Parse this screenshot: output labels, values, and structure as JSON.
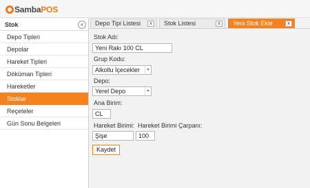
{
  "app": {
    "logo_samba": "Samba",
    "logo_pos": "POS"
  },
  "sidebar": {
    "title": "Stok",
    "collapse_icon": "«",
    "items": [
      {
        "label": "Depo Tipleri"
      },
      {
        "label": "Depolar"
      },
      {
        "label": "Hareket Tipleri"
      },
      {
        "label": "Döküman Tipleri"
      },
      {
        "label": "Hareketler"
      },
      {
        "label": "Stoklar",
        "active": true
      },
      {
        "label": "Reçeteler"
      },
      {
        "label": "Gün Sonu Belgeleri"
      }
    ]
  },
  "tabs": [
    {
      "label": "Depo Tipi Listesi",
      "close": "x"
    },
    {
      "label": "Stok Listesi",
      "close": "x"
    },
    {
      "label": "Yeni Stok Ekle",
      "close": "x",
      "active": true
    }
  ],
  "form": {
    "stock_name_label": "Stok Adı:",
    "stock_name_value": "Yeni Rakı 100 CL",
    "group_code_label": "Grup Kodu:",
    "group_code_value": "Alkollu İçecekler",
    "warehouse_label": "Depo:",
    "warehouse_value": "Yerel Depo",
    "base_unit_label": "Ana Birim:",
    "base_unit_value": "CL",
    "movement_unit_label": "Hareket Birimi:",
    "movement_unit_value": "Şişe",
    "multiplier_label": "Hareket Birimi Çarpanı:",
    "multiplier_value": "100",
    "save_label": "Kaydet",
    "dropdown_arrow": "▾"
  },
  "colors": {
    "accent": "#f5821f"
  }
}
